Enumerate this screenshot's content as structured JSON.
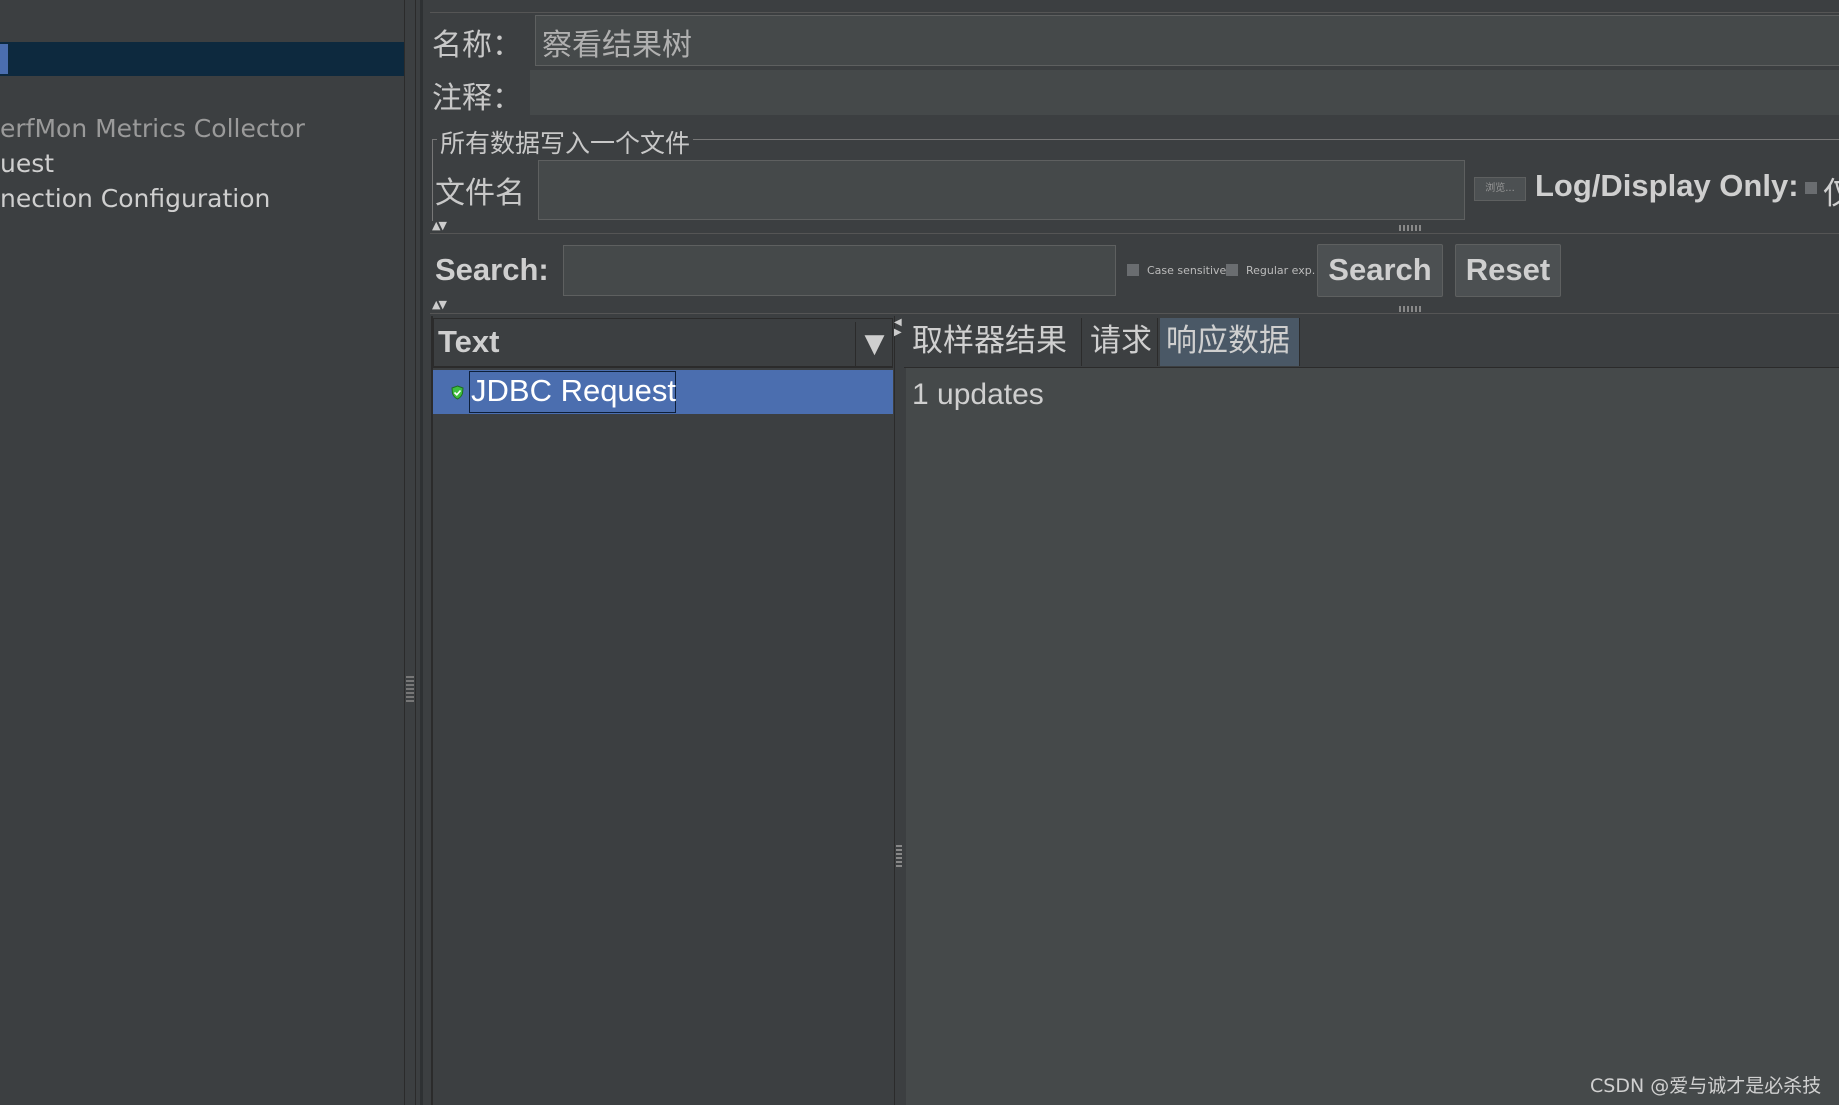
{
  "tree": {
    "items": [
      {
        "label": "erfMon Metrics Collector"
      },
      {
        "label": "uest"
      },
      {
        "label": "nection Configuration"
      }
    ]
  },
  "form": {
    "name_label": "名称：",
    "name_value": "察看结果树",
    "comment_label": "注释：",
    "comment_value": "",
    "fieldset_legend": "所有数据写入一个文件",
    "filename_label": "文件名",
    "filename_value": "",
    "browse_label": "浏览...",
    "log_display_label": "Log/Display Only:",
    "log_display_clip": "仅"
  },
  "search": {
    "label": "Search:",
    "value": "",
    "case_sensitive_label": "Case sensitive",
    "regex_label": "Regular exp.",
    "search_button": "Search",
    "reset_button": "Reset"
  },
  "results": {
    "renderer_label": "Text",
    "renderer_arrow": "▼",
    "rows": [
      {
        "label": "JDBC Request",
        "status": "success",
        "icon": "success-shield-icon"
      }
    ]
  },
  "tabs": [
    {
      "label": "取样器结果",
      "selected": false
    },
    {
      "label": "请求",
      "selected": false
    },
    {
      "label": "响应数据",
      "selected": true
    }
  ],
  "response": {
    "text": "1 updates"
  },
  "watermark": "CSDN @爱与诚才是必杀技",
  "colors": {
    "background": "#3c3f41",
    "selection": "#4b6eaf",
    "tree_selection": "#0d293e",
    "selected_tab": "#4a5866",
    "success_green": "#3fbf3f"
  }
}
